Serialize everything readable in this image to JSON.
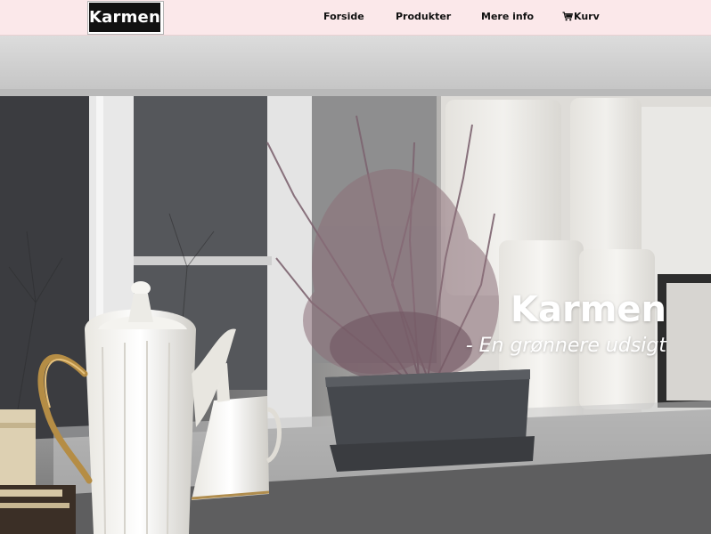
{
  "brand": {
    "logo_text": "Karmen"
  },
  "nav": {
    "items": [
      {
        "label": "Forside"
      },
      {
        "label": "Produkter"
      },
      {
        "label": "Mere info"
      },
      {
        "label": "Kurv",
        "icon": "cart-icon"
      }
    ]
  },
  "hero": {
    "title": "Karmen",
    "subtitle": "- En grønnere udsigt",
    "image": "heather-plant-and-teapot-on-windowsill"
  },
  "colors": {
    "nav_background": "#fbe8ea",
    "logo_background": "#111111",
    "logo_text": "#ffffff",
    "nav_text": "#111111",
    "hero_text": "#ffffff"
  }
}
